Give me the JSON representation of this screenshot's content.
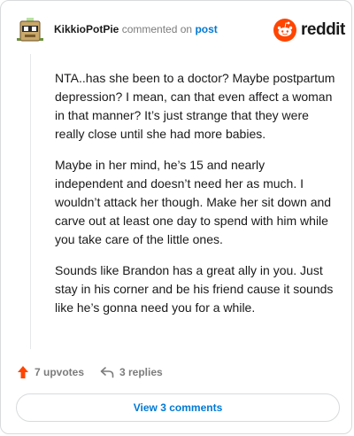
{
  "comment": {
    "username": "KikkioPotPie",
    "action_text": "commented on",
    "post_link": "post",
    "avatar": "snoo-avatar-icon",
    "paragraphs": [
      "NTA..has she been to a doctor? Maybe postpartum depression? I mean, can that even affect a woman in that manner? It’s just strange that they were really close until she had more babies.",
      "Maybe in her mind, he’s 15 and nearly independent and doesn’t need her as much. I wouldn’t attack her though. Make her sit down and carve out at least one day to spend with him while you take care of the little ones.",
      "Sounds like Brandon has a great ally in you. Just stay in his corner and be his friend cause it sounds like he’s gonna need you for a while."
    ]
  },
  "brand": {
    "name": "reddit",
    "icon": "reddit-logo-icon",
    "color": "#ff4500"
  },
  "actions": {
    "upvotes": "7 upvotes",
    "upvote_icon": "upvote-arrow-icon",
    "upvote_color": "#ff4500",
    "replies": "3 replies",
    "reply_icon": "reply-arrow-icon"
  },
  "footer": {
    "view_label": "View 3 comments"
  },
  "colors": {
    "link": "#0079d3",
    "muted": "#7c7c7c",
    "text": "#1a1a1b"
  }
}
